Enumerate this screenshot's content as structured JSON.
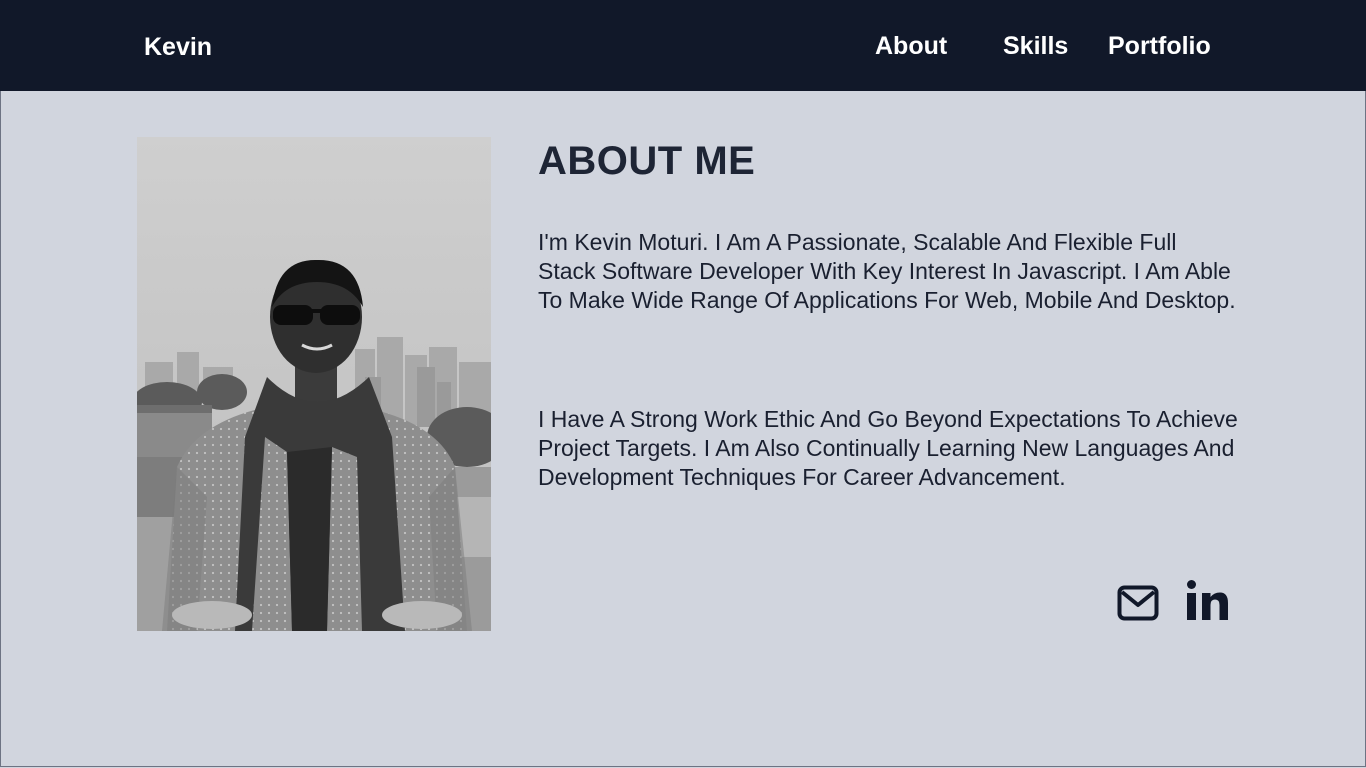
{
  "navbar": {
    "brand": "Kevin",
    "links": [
      {
        "label": "About"
      },
      {
        "label": "Skills"
      },
      {
        "label": "Portfolio"
      }
    ]
  },
  "about": {
    "heading": "ABOUT ME",
    "paragraphs": [
      "I'm Kevin Moturi. I Am A Passionate, Scalable And Flexible Full Stack Software Developer With Key Interest In Javascript. I Am Able To Make Wide Range Of Applications For Web, Mobile And Desktop.",
      "I Have A Strong Work Ethic And Go Beyond Expectations To Achieve Project Targets. I Am Also Continually Learning New Languages And Development Techniques For Career Advancement."
    ],
    "photo": {
      "icon": "profile-photo"
    }
  },
  "social": [
    {
      "icon": "mail-icon"
    },
    {
      "icon": "linkedin-icon"
    }
  ],
  "colors": {
    "navbar_bg": "#111829",
    "page_bg": "#d1d5de",
    "text": "#1a2030",
    "nav_text": "#ffffff"
  }
}
